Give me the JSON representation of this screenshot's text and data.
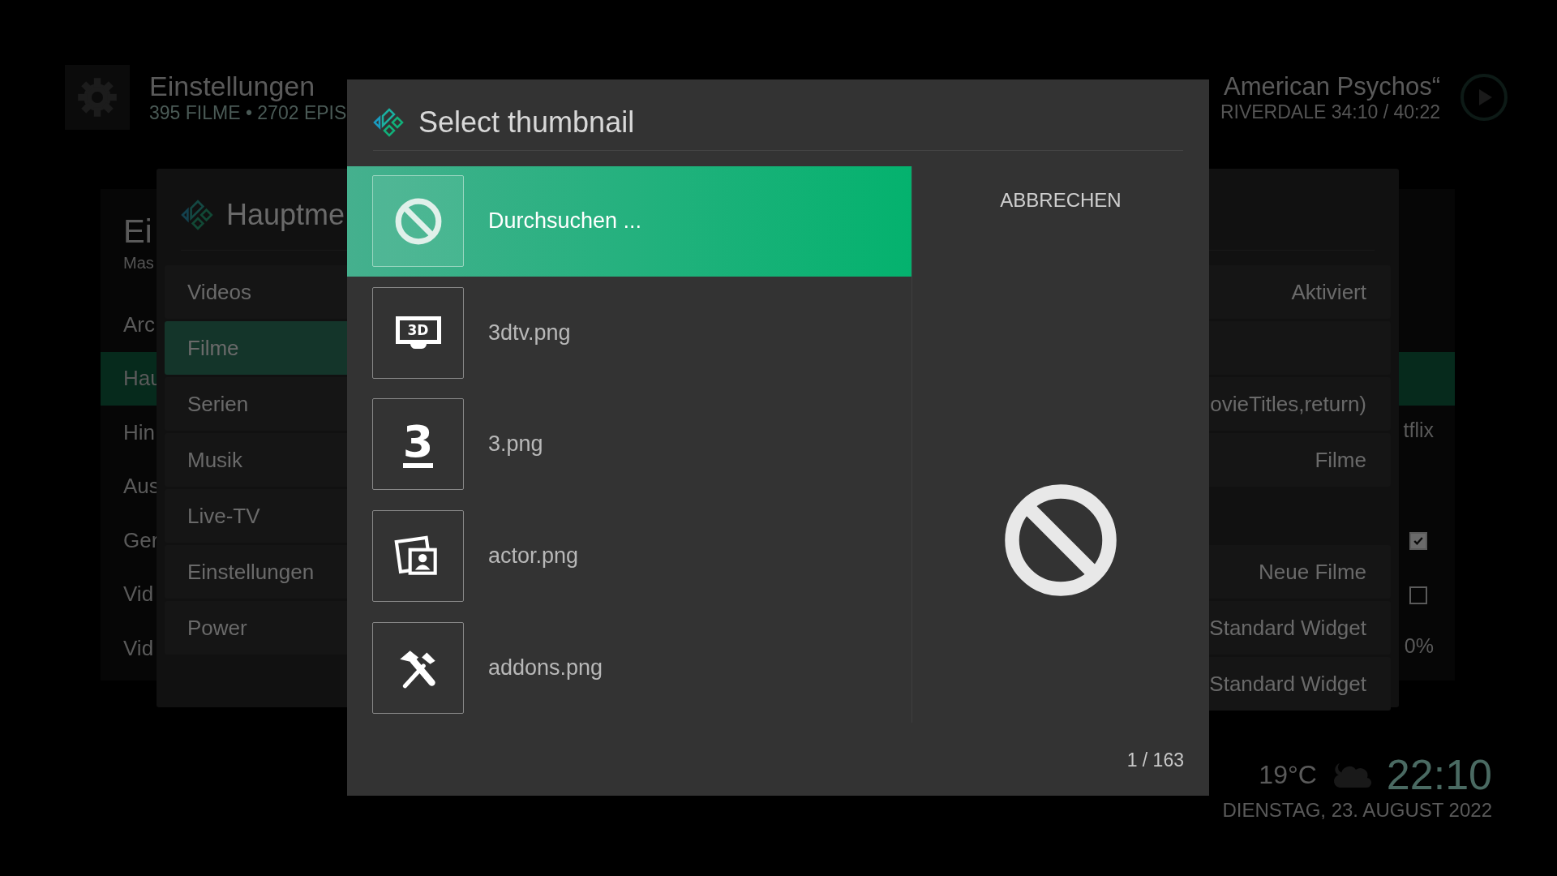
{
  "header": {
    "title": "Einstellungen",
    "subtitle": "395 FILME  •  2702 EPIS",
    "now_playing_title": "American Psychos“",
    "now_playing_info": "RIVERDALE  34:10 / 40:22"
  },
  "settings_panel": {
    "title": "Ei",
    "subtitle": "Mas",
    "items": [
      {
        "label": "Arc",
        "selected": false
      },
      {
        "label": "Hau",
        "selected": true
      },
      {
        "label": "Hin",
        "selected": false,
        "kind": "text",
        "value": "tflix"
      },
      {
        "label": "Aus",
        "selected": false
      },
      {
        "label": "Ger",
        "selected": false,
        "kind": "checkbox",
        "checked": true
      },
      {
        "label": "Vid",
        "selected": false,
        "kind": "checkbox",
        "checked": false
      },
      {
        "label": "Vid",
        "selected": false,
        "kind": "text",
        "value": "0%"
      }
    ]
  },
  "menu_dialog": {
    "title": "Hauptme",
    "items": [
      {
        "label": "Videos",
        "selected": false
      },
      {
        "label": "Filme",
        "selected": true
      },
      {
        "label": "Serien",
        "selected": false
      },
      {
        "label": "Musik",
        "selected": false
      },
      {
        "label": "Live-TV",
        "selected": false
      },
      {
        "label": "Einstellungen",
        "selected": false
      },
      {
        "label": "Power",
        "selected": false
      }
    ],
    "settings": [
      {
        "kind": "value",
        "value": "Aktiviert"
      },
      {
        "kind": "blank"
      },
      {
        "kind": "value",
        "value": "ovieTitles,return)"
      },
      {
        "kind": "value",
        "value": "Filme"
      },
      {
        "kind": "gap"
      },
      {
        "kind": "value",
        "value": "Neue Filme"
      },
      {
        "kind": "value",
        "value": "Standard Widget"
      },
      {
        "kind": "value",
        "value": "Standard Widget"
      }
    ]
  },
  "thumbnail_dialog": {
    "title": "Select thumbnail",
    "items": [
      {
        "label": "Durchsuchen ...",
        "selected": true,
        "kind": "none"
      },
      {
        "label": "3dtv.png",
        "selected": false,
        "kind": "tv",
        "icon_text": "3D"
      },
      {
        "label": "3.png",
        "selected": false,
        "kind": "number",
        "icon_text": "3"
      },
      {
        "label": "actor.png",
        "selected": false,
        "kind": "actor"
      },
      {
        "label": "addons.png",
        "selected": false,
        "kind": "tools"
      }
    ],
    "cancel_button": "ABBRECHEN",
    "counter": "1 / 163"
  },
  "clock": {
    "temperature": "19°C",
    "time": "22:10",
    "date": "DIENSTAG, 23. AUGUST 2022"
  }
}
